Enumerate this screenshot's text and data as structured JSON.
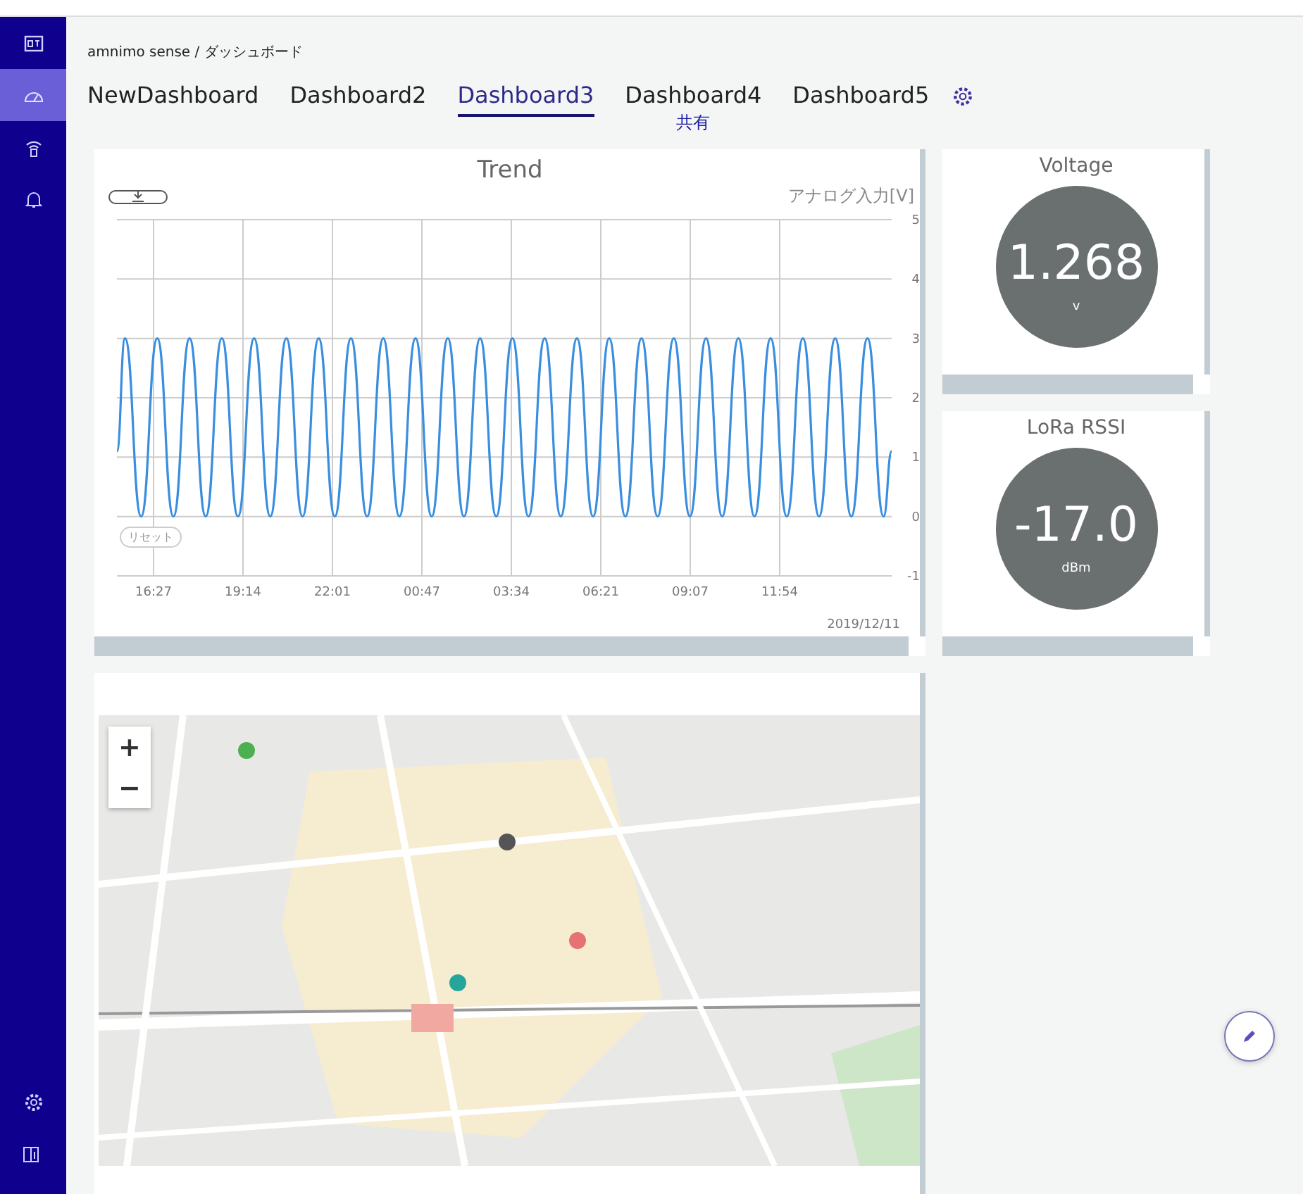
{
  "sidebar": {
    "items": [
      {
        "kind": "logo",
        "selected": false
      },
      {
        "kind": "gauge",
        "selected": true
      },
      {
        "kind": "sensor",
        "selected": false
      },
      {
        "kind": "bell",
        "selected": false
      }
    ],
    "bottom_items": [
      {
        "kind": "gear",
        "selected": false
      },
      {
        "kind": "book",
        "selected": false
      }
    ]
  },
  "breadcrumb": "amnimo sense / ダッシュボード",
  "tabs": [
    {
      "label": "NewDashboard",
      "selected": false
    },
    {
      "label": "Dashboard2",
      "selected": false
    },
    {
      "label": "Dashboard3",
      "selected": true
    },
    {
      "label": "Dashboard4",
      "selected": false,
      "badge": "共有"
    },
    {
      "label": "Dashboard5",
      "selected": false
    }
  ],
  "trend": {
    "title": "Trend",
    "y_axis_label": "アナログ入力[V]",
    "reset_button": "リセット",
    "date": "2019/12/11",
    "y_ticks": [
      "5",
      "4",
      "3",
      "2",
      "1",
      "0",
      "-1"
    ],
    "x_ticks": [
      "16:27",
      "19:14",
      "22:01",
      "00:47",
      "03:34",
      "06:21",
      "09:07",
      "11:54"
    ]
  },
  "gauges": [
    {
      "title": "Voltage",
      "value": "1.268",
      "unit": "v"
    },
    {
      "title": "LoRa RSSI",
      "value": "-17.0",
      "unit": "dBm"
    }
  ],
  "map": {
    "zoom_in": "+",
    "zoom_out": "−"
  }
}
